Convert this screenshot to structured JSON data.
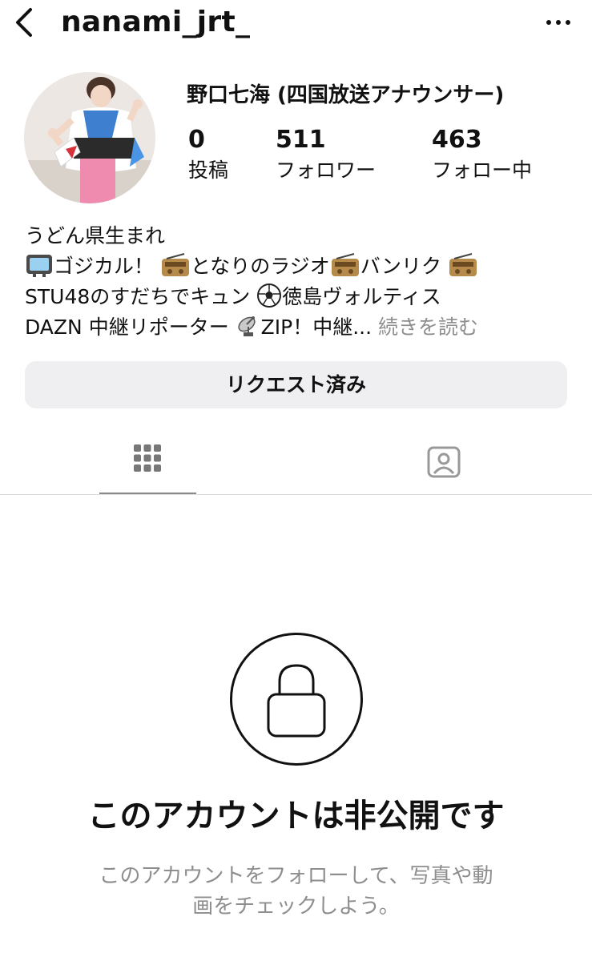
{
  "header": {
    "username": "nanami_jrt_",
    "back_icon": "chevron-left-icon",
    "more_icon": "more-horizontal-icon"
  },
  "profile": {
    "display_name": "野口七海 (四国放送アナウンサー)",
    "stats": {
      "posts": {
        "value": "0",
        "label": "投稿"
      },
      "followers": {
        "value": "511",
        "label": "フォロワー"
      },
      "following": {
        "value": "463",
        "label": "フォロー中"
      }
    },
    "bio": {
      "line1": "うどん県生まれ",
      "line2_a": "ゴジカル！",
      "line2_b": "となりのラジオ",
      "line2_c": "バンリク",
      "line3_a": "STU48のすだちでキュン",
      "line3_b": "徳島ヴォルティス",
      "line4_a": "DAZN 中継リポーター",
      "line4_b": "ZIP！中継...",
      "more_link": "続きを読む"
    }
  },
  "actions": {
    "request_button": "リクエスト済み"
  },
  "tabs": {
    "grid_icon": "grid-icon",
    "tagged_icon": "tagged-person-icon"
  },
  "private": {
    "lock_icon": "lock-icon",
    "title": "このアカウントは非公開です",
    "description_line1": "このアカウントをフォローして、写真や動",
    "description_line2": "画をチェックしよう。"
  },
  "colors": {
    "text": "#111111",
    "secondary_text": "#8e8e8e",
    "button_bg": "#efeff1",
    "divider": "#dbdbdb"
  }
}
